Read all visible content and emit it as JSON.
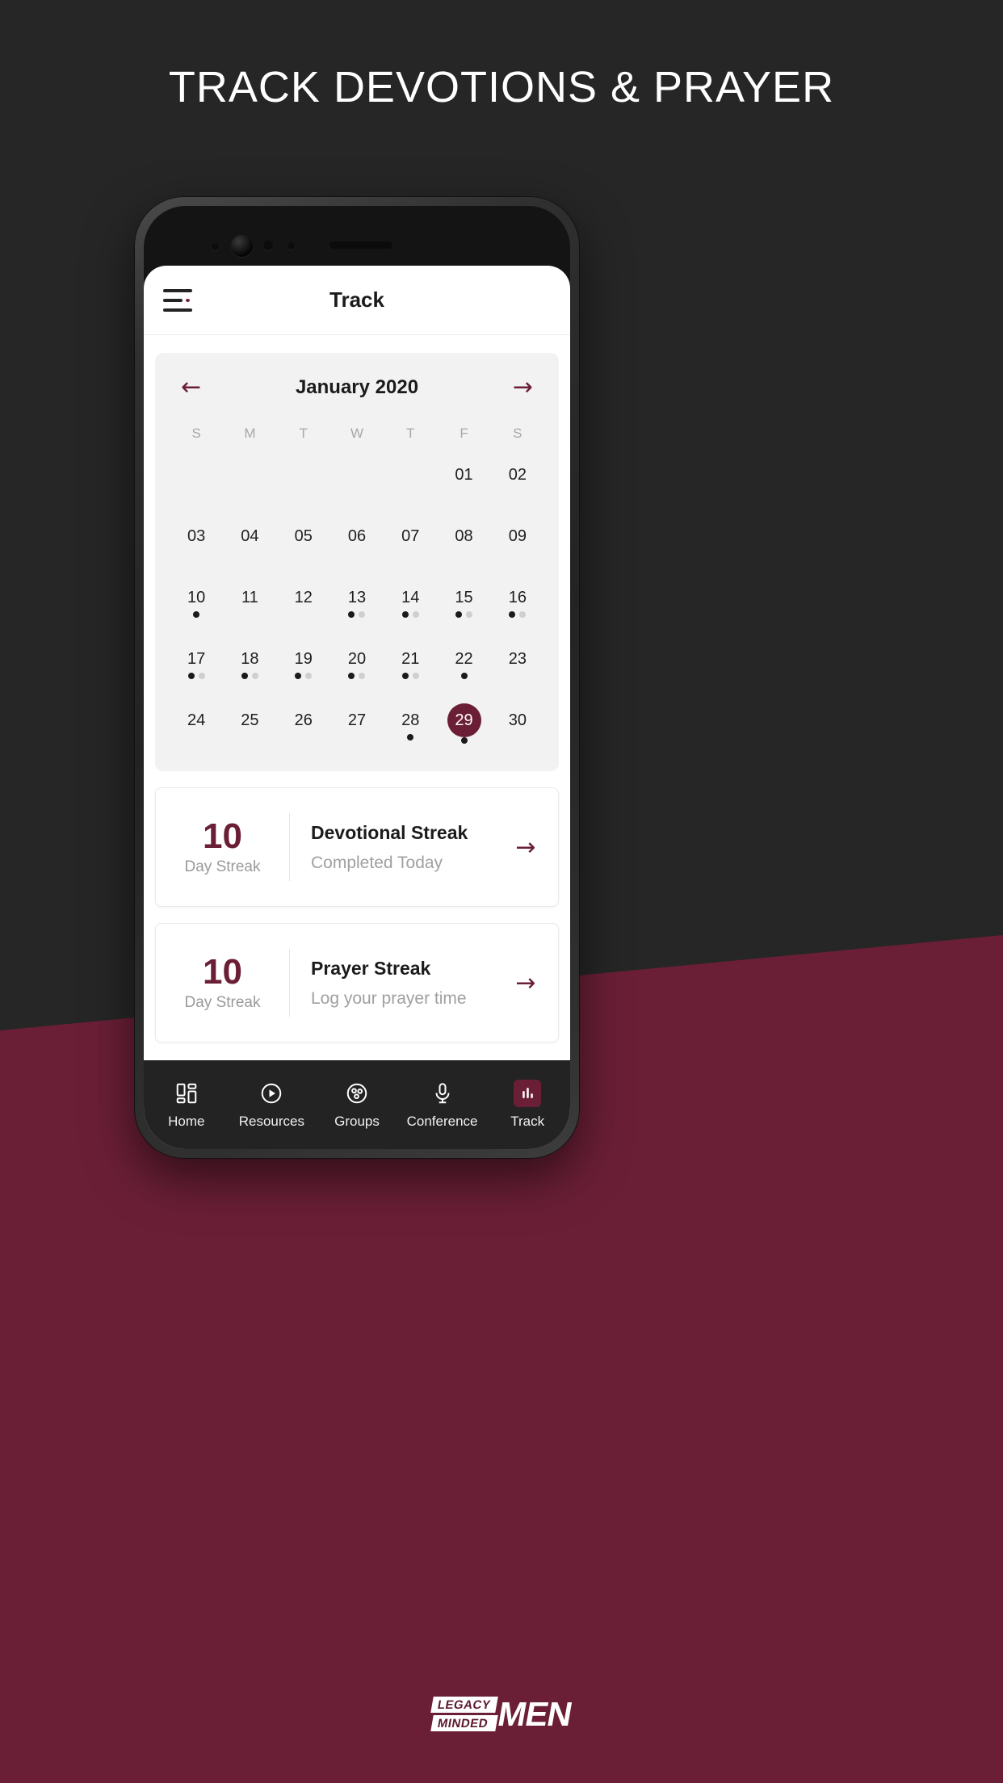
{
  "headline": "TRACK DEVOTIONS & PRAYER",
  "colors": {
    "background_dark": "#262626",
    "background_maroon": "#6b1f36",
    "accent": "#6b1f36",
    "card_grey": "#f2f2f2",
    "nav_bar": "#232323"
  },
  "app": {
    "appbar": {
      "menu_icon": "hamburger-menu-icon",
      "title": "Track"
    },
    "calendar": {
      "prev_icon": "arrow-left-icon",
      "next_icon": "arrow-right-icon",
      "month_label": "January 2020",
      "weekday_headers": [
        "S",
        "M",
        "T",
        "W",
        "T",
        "F",
        "S"
      ],
      "weeks": [
        [
          {
            "label": "",
            "blank": true
          },
          {
            "label": "",
            "blank": true
          },
          {
            "label": "",
            "blank": true
          },
          {
            "label": "",
            "blank": true
          },
          {
            "label": "",
            "blank": true
          },
          {
            "label": "01",
            "dots": []
          },
          {
            "label": "02",
            "dots": []
          }
        ],
        [
          {
            "label": "03",
            "dots": []
          },
          {
            "label": "04",
            "dots": []
          },
          {
            "label": "05",
            "dots": []
          },
          {
            "label": "06",
            "dots": []
          },
          {
            "label": "07",
            "dots": []
          },
          {
            "label": "08",
            "dots": []
          },
          {
            "label": "09",
            "dots": []
          }
        ],
        [
          {
            "label": "10",
            "dots": [
              "dark"
            ]
          },
          {
            "label": "11",
            "dots": []
          },
          {
            "label": "12",
            "dots": []
          },
          {
            "label": "13",
            "dots": [
              "dark",
              "light"
            ]
          },
          {
            "label": "14",
            "dots": [
              "dark",
              "light"
            ]
          },
          {
            "label": "15",
            "dots": [
              "dark",
              "light"
            ]
          },
          {
            "label": "16",
            "dots": [
              "dark",
              "light"
            ]
          }
        ],
        [
          {
            "label": "17",
            "dots": [
              "dark",
              "light"
            ]
          },
          {
            "label": "18",
            "dots": [
              "dark",
              "light"
            ]
          },
          {
            "label": "19",
            "dots": [
              "dark",
              "light"
            ]
          },
          {
            "label": "20",
            "dots": [
              "dark",
              "light"
            ]
          },
          {
            "label": "21",
            "dots": [
              "dark",
              "light"
            ]
          },
          {
            "label": "22",
            "dots": [
              "dark"
            ]
          },
          {
            "label": "23",
            "dots": []
          }
        ],
        [
          {
            "label": "24",
            "dots": []
          },
          {
            "label": "25",
            "dots": []
          },
          {
            "label": "26",
            "dots": []
          },
          {
            "label": "27",
            "dots": []
          },
          {
            "label": "28",
            "dots": [
              "dark"
            ]
          },
          {
            "label": "29",
            "dots": [
              "dark"
            ],
            "selected": true
          },
          {
            "label": "30",
            "dots": []
          }
        ]
      ]
    },
    "streaks": [
      {
        "count": "10",
        "count_label": "Day Streak",
        "title": "Devotional Streak",
        "description": "Completed Today",
        "arrow_icon": "arrow-right-icon"
      },
      {
        "count": "10",
        "count_label": "Day Streak",
        "title": "Prayer Streak",
        "description": "Log your prayer time",
        "arrow_icon": "arrow-right-icon"
      }
    ],
    "bottom_nav": [
      {
        "label": "Home",
        "icon": "dashboard-tiles-icon",
        "active": false
      },
      {
        "label": "Resources",
        "icon": "play-circle-icon",
        "active": false
      },
      {
        "label": "Groups",
        "icon": "group-people-circle-icon",
        "active": false
      },
      {
        "label": "Conference",
        "icon": "microphone-icon",
        "active": false
      },
      {
        "label": "Track",
        "icon": "bar-chart-icon",
        "active": true
      }
    ]
  },
  "logo": {
    "line1": "LEGACY",
    "line2": "MINDED",
    "word": "MEN"
  }
}
